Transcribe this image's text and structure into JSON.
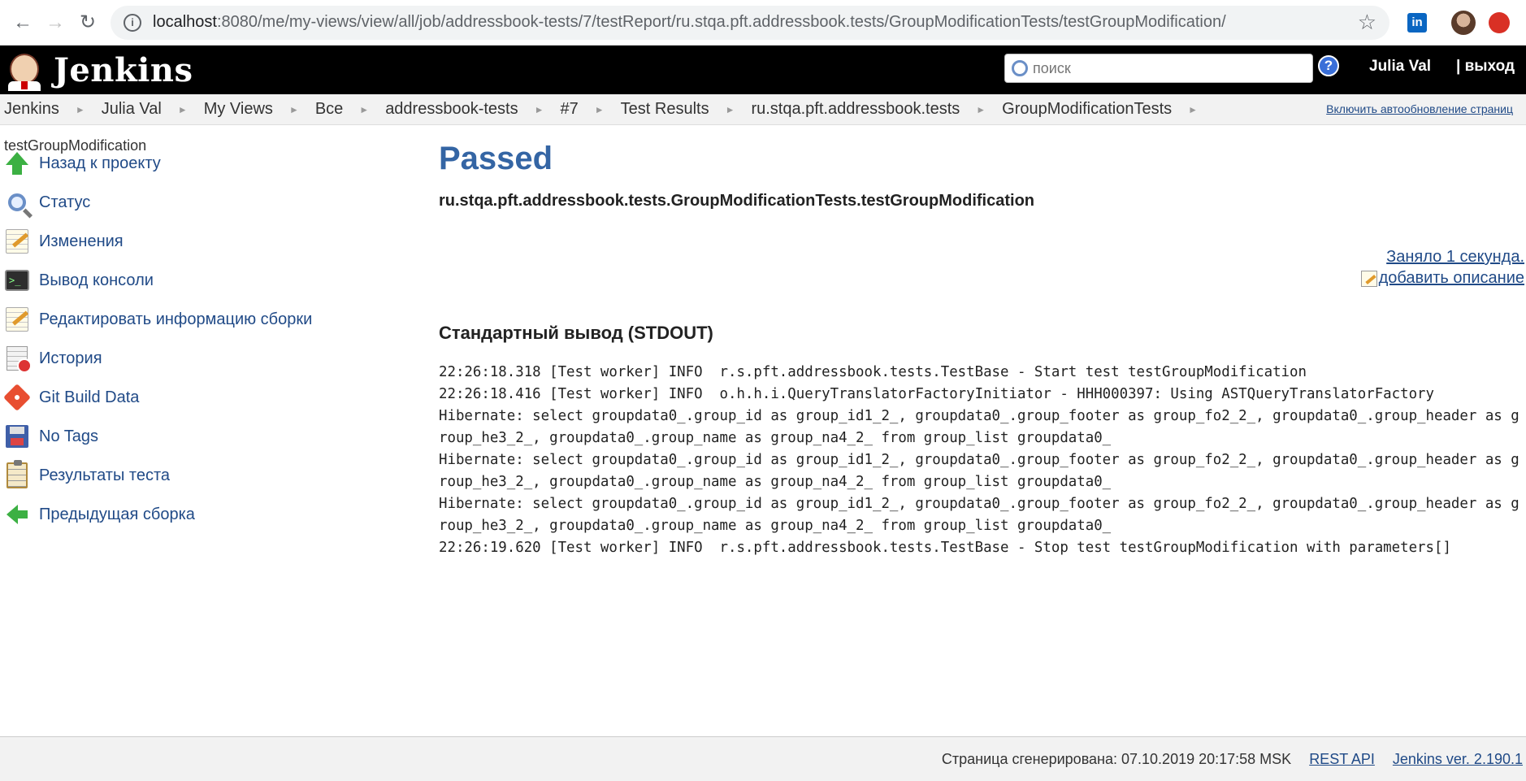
{
  "browser": {
    "url_host": "localhost",
    "url_rest": ":8080/me/my-views/view/all/job/addressbook-tests/7/testReport/ru.stqa.pft.addressbook.tests/GroupModificationTests/testGroupModification/",
    "back": "←",
    "forward": "→",
    "reload": "↻",
    "star": "☆",
    "linkedin": "in"
  },
  "header": {
    "title": "Jenkins",
    "search_placeholder": "поиск",
    "help": "?",
    "user": "Julia Val",
    "logout": "| выход"
  },
  "breadcrumb": {
    "items": [
      "Jenkins",
      "Julia Val",
      "My Views",
      "Все",
      "addressbook-tests",
      "#7",
      "Test Results",
      "ru.stqa.pft.addressbook.tests",
      "GroupModificationTests"
    ],
    "separator": "►",
    "autorefresh": "Включить автообновление страниц"
  },
  "sidebar": {
    "title": "testGroupModification",
    "items": [
      {
        "label": "Назад к проекту",
        "icon": "up-arrow-icon"
      },
      {
        "label": "Статус",
        "icon": "magnifier-icon"
      },
      {
        "label": "Изменения",
        "icon": "notepad-icon"
      },
      {
        "label": "Вывод консоли",
        "icon": "terminal-icon"
      },
      {
        "label": "Редактировать информацию сборки",
        "icon": "notepad-icon"
      },
      {
        "label": "История",
        "icon": "history-icon"
      },
      {
        "label": "Git Build Data",
        "icon": "git-icon"
      },
      {
        "label": "No Tags",
        "icon": "floppy-icon"
      },
      {
        "label": "Результаты теста",
        "icon": "clipboard-icon"
      },
      {
        "label": "Предыдущая сборка",
        "icon": "left-arrow-icon"
      }
    ]
  },
  "main": {
    "status": "Passed",
    "test_name": "ru.stqa.pft.addressbook.tests.GroupModificationTests.testGroupModification",
    "duration": "Заняло 1 секунда.",
    "add_description": "добавить описание",
    "stdout_heading": "Стандартный вывод (STDOUT)",
    "stdout": "22:26:18.318 [Test worker] INFO  r.s.pft.addressbook.tests.TestBase - Start test testGroupModification\n22:26:18.416 [Test worker] INFO  o.h.h.i.QueryTranslatorFactoryInitiator - HHH000397: Using ASTQueryTranslatorFactory\nHibernate: select groupdata0_.group_id as group_id1_2_, groupdata0_.group_footer as group_fo2_2_, groupdata0_.group_header as group_he3_2_, groupdata0_.group_name as group_na4_2_ from group_list groupdata0_\nHibernate: select groupdata0_.group_id as group_id1_2_, groupdata0_.group_footer as group_fo2_2_, groupdata0_.group_header as group_he3_2_, groupdata0_.group_name as group_na4_2_ from group_list groupdata0_\nHibernate: select groupdata0_.group_id as group_id1_2_, groupdata0_.group_footer as group_fo2_2_, groupdata0_.group_header as group_he3_2_, groupdata0_.group_name as group_na4_2_ from group_list groupdata0_\n22:26:19.620 [Test worker] INFO  r.s.pft.addressbook.tests.TestBase - Stop test testGroupModification with parameters[]"
  },
  "footer": {
    "generated": "Страница сгенерирована: 07.10.2019 20:17:58 MSK",
    "rest_api": "REST API",
    "version": "Jenkins ver. 2.190.1"
  }
}
